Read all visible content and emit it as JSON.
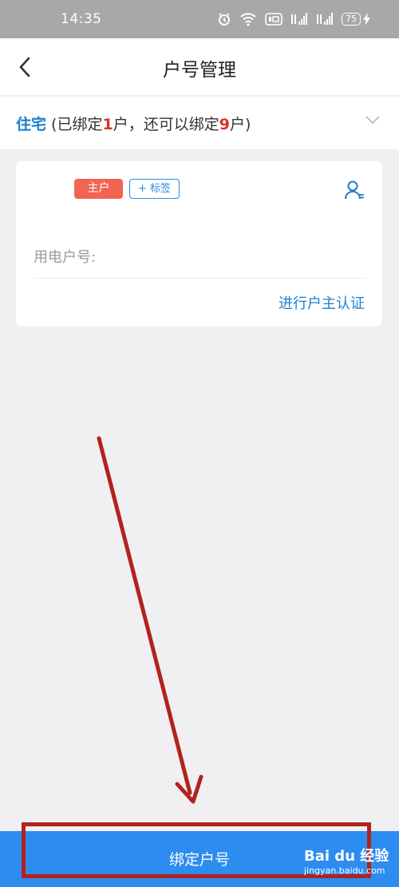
{
  "status_bar": {
    "time": "14:35",
    "battery": "75"
  },
  "header": {
    "title": "户号管理"
  },
  "type_selector": {
    "category": "住宅",
    "open_paren": " (已绑定",
    "bound_count": "1",
    "mid_text": "户，还可以绑定",
    "remaining_count": "9",
    "close_text": "户)"
  },
  "account_card": {
    "owner_badge": "主户",
    "tag_button": "+ 标签",
    "account_label": "用电户号:",
    "verify_link": "进行户主认证"
  },
  "footer": {
    "bind_button": "绑定户号"
  },
  "watermark": {
    "logo": "Bai du 经验",
    "url": "jingyan.baidu.com"
  },
  "colors": {
    "accent": "#1b7fd1",
    "primary_button": "#2d8cf0",
    "owner_badge": "#f26552",
    "count_highlight": "#d93025",
    "annotation": "#b3221d"
  }
}
